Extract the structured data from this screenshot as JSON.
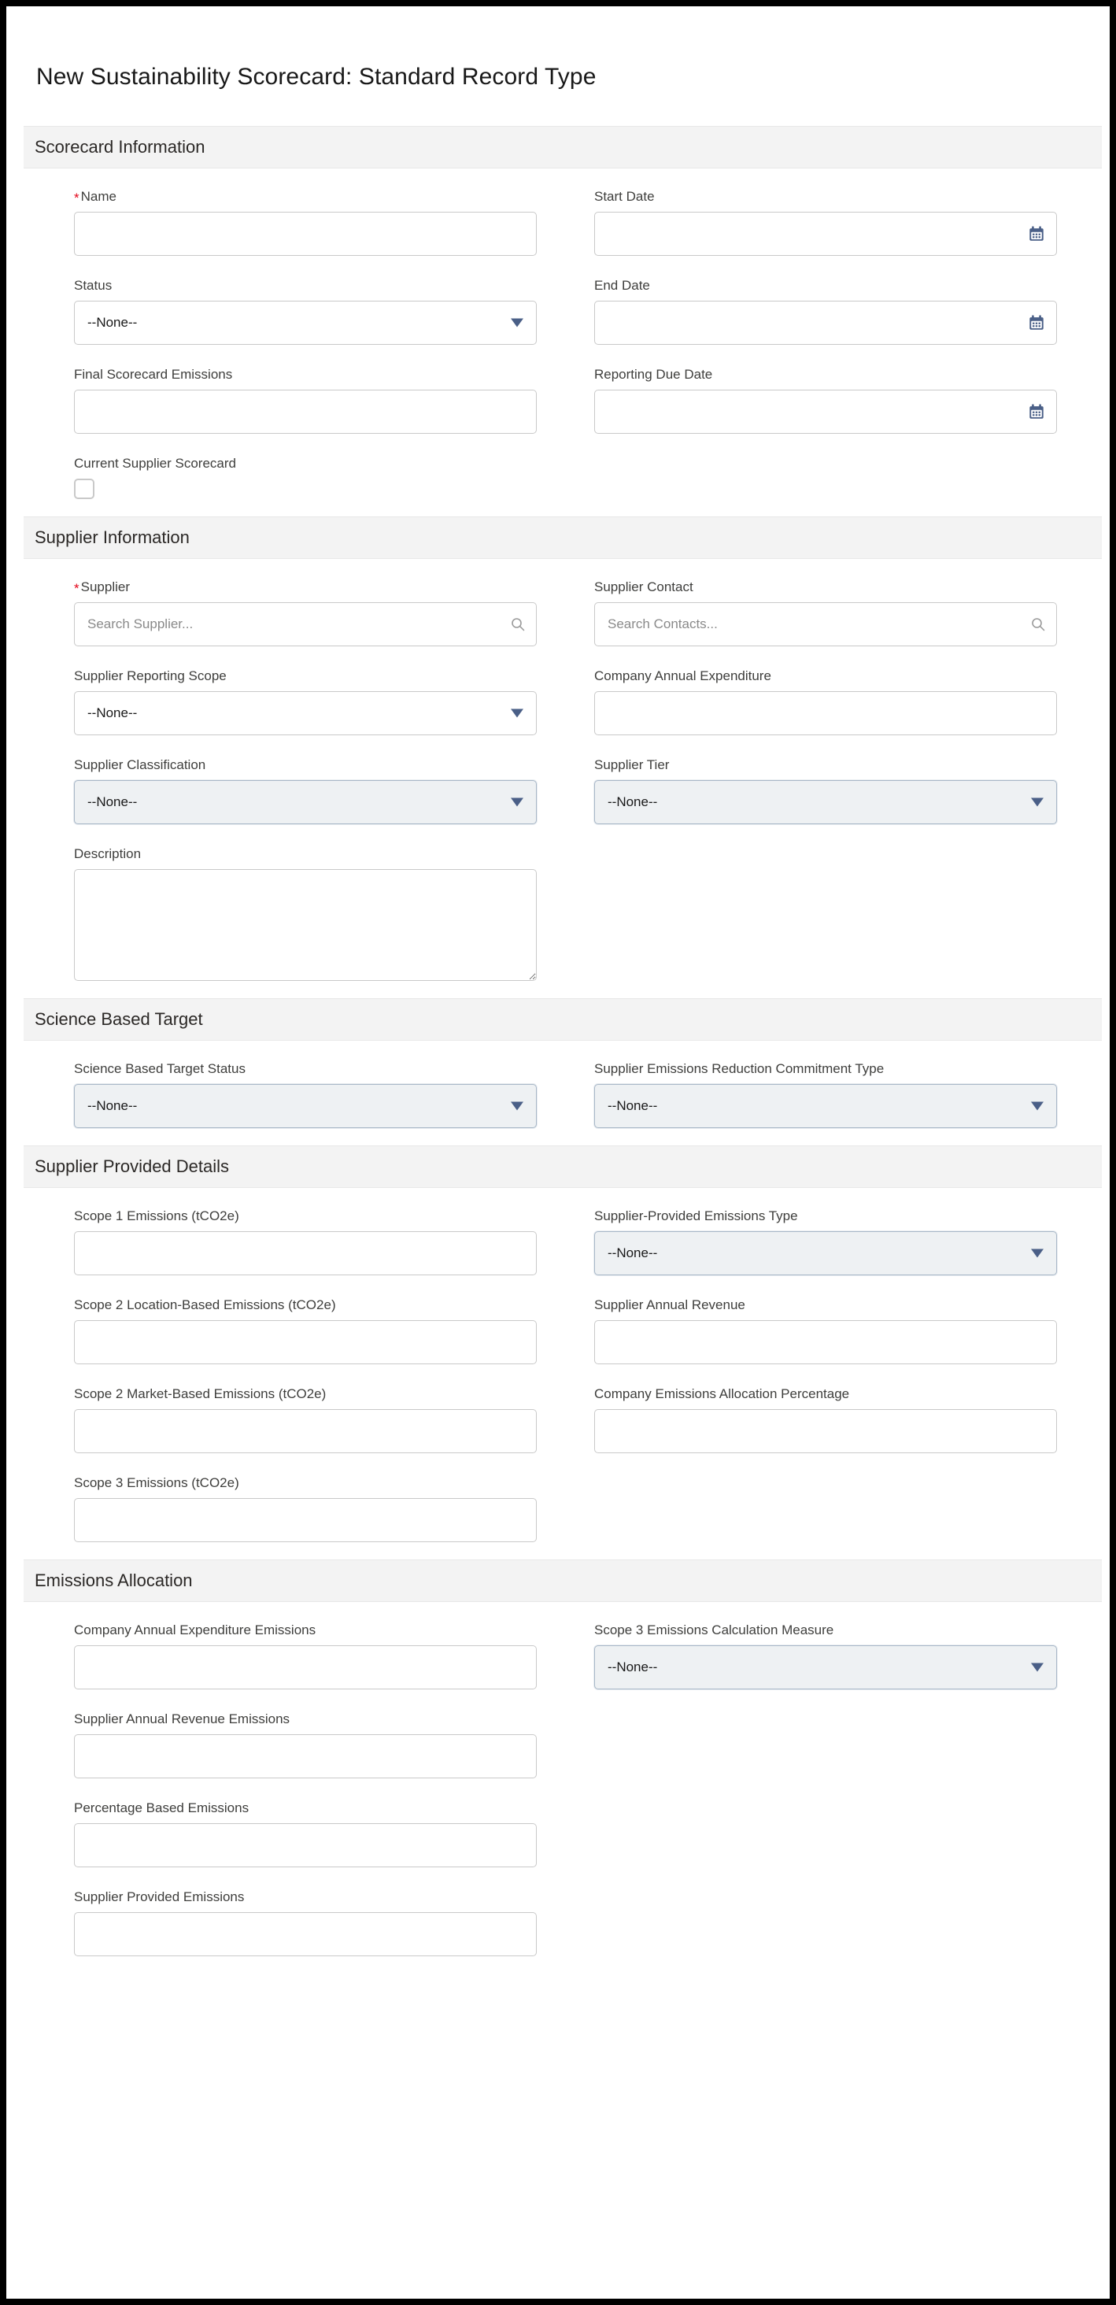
{
  "page": {
    "title": "New Sustainability Scorecard: Standard Record Type"
  },
  "common": {
    "none_option": "--None--",
    "calendar_icon": "calendar-icon",
    "search_icon": "search-icon",
    "caret_icon": "chevron-down-icon",
    "required_marker": "*"
  },
  "colors": {
    "required_red": "#e3061a",
    "icon_blue": "#4a5f87",
    "section_band": "#f3f3f3",
    "border_gray": "#c9c9c9"
  },
  "sections": [
    {
      "id": "scorecard-information",
      "title": "Scorecard Information",
      "fields": [
        {
          "id": "name",
          "label": "Name",
          "required": true,
          "type": "text",
          "value": "",
          "placeholder": "",
          "column": "left"
        },
        {
          "id": "start-date",
          "label": "Start Date",
          "required": false,
          "type": "date",
          "value": "",
          "placeholder": "",
          "column": "right"
        },
        {
          "id": "status",
          "label": "Status",
          "required": false,
          "type": "select",
          "value": "--None--",
          "highlighted": false,
          "column": "left"
        },
        {
          "id": "end-date",
          "label": "End Date",
          "required": false,
          "type": "date",
          "value": "",
          "placeholder": "",
          "column": "right"
        },
        {
          "id": "final-scorecard-emissions",
          "label": "Final Scorecard Emissions",
          "required": false,
          "type": "text",
          "value": "",
          "placeholder": "",
          "column": "left"
        },
        {
          "id": "reporting-due-date",
          "label": "Reporting Due Date",
          "required": false,
          "type": "date",
          "value": "",
          "placeholder": "",
          "column": "right"
        },
        {
          "id": "current-supplier-scorecard",
          "label": "Current Supplier Scorecard",
          "required": false,
          "type": "checkbox",
          "checked": false,
          "column": "left"
        }
      ]
    },
    {
      "id": "supplier-information",
      "title": "Supplier Information",
      "fields": [
        {
          "id": "supplier",
          "label": "Supplier",
          "required": true,
          "type": "lookup",
          "value": "",
          "placeholder": "Search Supplier...",
          "column": "left"
        },
        {
          "id": "supplier-contact",
          "label": "Supplier Contact",
          "required": false,
          "type": "lookup",
          "value": "",
          "placeholder": "Search Contacts...",
          "column": "right"
        },
        {
          "id": "supplier-reporting-scope",
          "label": "Supplier Reporting Scope",
          "required": false,
          "type": "select",
          "value": "--None--",
          "highlighted": false,
          "column": "left"
        },
        {
          "id": "company-annual-expenditure",
          "label": "Company Annual Expenditure",
          "required": false,
          "type": "text",
          "value": "",
          "placeholder": "",
          "column": "right"
        },
        {
          "id": "supplier-classification",
          "label": "Supplier Classification",
          "required": false,
          "type": "select",
          "value": "--None--",
          "highlighted": true,
          "column": "left"
        },
        {
          "id": "supplier-tier",
          "label": "Supplier Tier",
          "required": false,
          "type": "select",
          "value": "--None--",
          "highlighted": true,
          "column": "right"
        },
        {
          "id": "description",
          "label": "Description",
          "required": false,
          "type": "textarea",
          "value": "",
          "placeholder": "",
          "column": "left"
        }
      ]
    },
    {
      "id": "science-based-target",
      "title": "Science Based Target",
      "fields": [
        {
          "id": "science-based-target-status",
          "label": "Science Based Target Status",
          "required": false,
          "type": "select",
          "value": "--None--",
          "highlighted": true,
          "column": "left"
        },
        {
          "id": "supplier-emissions-reduction-commitment-type",
          "label": "Supplier Emissions Reduction Commitment Type",
          "required": false,
          "type": "select",
          "value": "--None--",
          "highlighted": true,
          "column": "right"
        }
      ]
    },
    {
      "id": "supplier-provided-details",
      "title": "Supplier Provided Details",
      "fields": [
        {
          "id": "scope-1-emissions",
          "label": "Scope 1 Emissions (tCO2e)",
          "required": false,
          "type": "text",
          "value": "",
          "placeholder": "",
          "column": "left"
        },
        {
          "id": "supplier-provided-emissions-type",
          "label": "Supplier-Provided Emissions Type",
          "required": false,
          "type": "select",
          "value": "--None--",
          "highlighted": true,
          "column": "right"
        },
        {
          "id": "scope-2-location-based-emissions",
          "label": "Scope 2 Location-Based Emissions (tCO2e)",
          "required": false,
          "type": "text",
          "value": "",
          "placeholder": "",
          "column": "left"
        },
        {
          "id": "supplier-annual-revenue",
          "label": "Supplier Annual Revenue",
          "required": false,
          "type": "text",
          "value": "",
          "placeholder": "",
          "column": "right"
        },
        {
          "id": "scope-2-market-based-emissions",
          "label": "Scope 2 Market-Based Emissions (tCO2e)",
          "required": false,
          "type": "text",
          "value": "",
          "placeholder": "",
          "column": "left"
        },
        {
          "id": "company-emissions-allocation-percentage",
          "label": "Company Emissions Allocation Percentage",
          "required": false,
          "type": "text",
          "value": "",
          "placeholder": "",
          "column": "right"
        },
        {
          "id": "scope-3-emissions",
          "label": "Scope 3 Emissions (tCO2e)",
          "required": false,
          "type": "text",
          "value": "",
          "placeholder": "",
          "column": "left"
        }
      ]
    },
    {
      "id": "emissions-allocation",
      "title": "Emissions Allocation",
      "fields": [
        {
          "id": "company-annual-expenditure-emissions",
          "label": "Company Annual Expenditure Emissions",
          "required": false,
          "type": "text",
          "value": "",
          "placeholder": "",
          "column": "left"
        },
        {
          "id": "scope-3-emissions-calculation-measure",
          "label": "Scope 3 Emissions Calculation Measure",
          "required": false,
          "type": "select",
          "value": "--None--",
          "highlighted": true,
          "column": "right"
        },
        {
          "id": "supplier-annual-revenue-emissions",
          "label": "Supplier Annual Revenue Emissions",
          "required": false,
          "type": "text",
          "value": "",
          "placeholder": "",
          "column": "left"
        },
        {
          "id": "percentage-based-emissions",
          "label": "Percentage Based Emissions",
          "required": false,
          "type": "text",
          "value": "",
          "placeholder": "",
          "column": "left"
        },
        {
          "id": "supplier-provided-emissions",
          "label": "Supplier Provided Emissions",
          "required": false,
          "type": "text",
          "value": "",
          "placeholder": "",
          "column": "left"
        }
      ]
    }
  ]
}
